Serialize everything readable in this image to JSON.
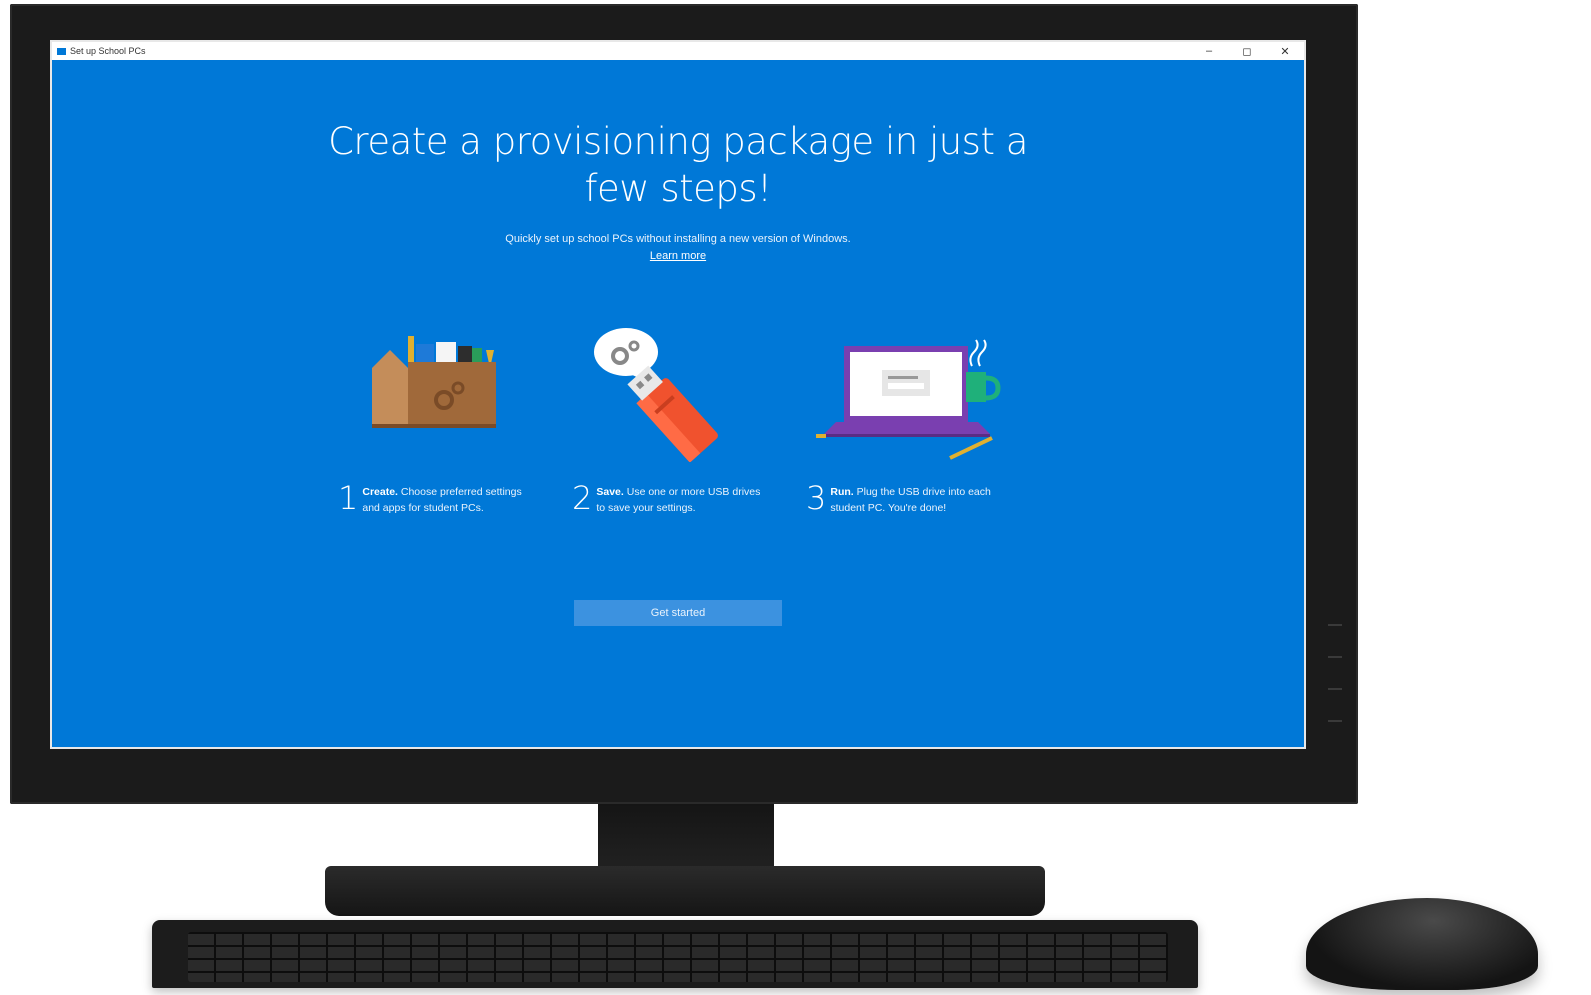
{
  "window": {
    "title": "Set up School PCs",
    "minimize": "–",
    "maximize": "◻",
    "close": "✕"
  },
  "main": {
    "headline_line1": "Create a provisioning package in just a",
    "headline_line2": "few steps!",
    "subtitle": "Quickly set up school PCs without installing a new version of Windows.",
    "learn_more": "Learn more",
    "steps": [
      {
        "number": "1",
        "bold": "Create.",
        "text_line1": " Choose preferred settings",
        "text_line2": "and apps for student PCs."
      },
      {
        "number": "2",
        "bold": "Save.",
        "text_line1": " Use one or more USB drives",
        "text_line2": "to save your settings."
      },
      {
        "number": "3",
        "bold": "Run.",
        "text_line1": " Plug the USB drive into each",
        "text_line2": "student PC. You're done!"
      }
    ],
    "get_started": "Get started"
  },
  "colors": {
    "screen_blue": "#0078d7",
    "button_blue": "#3c92e0",
    "toolbox_brown": "#a0693a",
    "usb_red": "#f0522e",
    "laptop_purple": "#7a3fb0",
    "mug_green": "#1fb07a"
  },
  "icons": [
    "toolbox-illustration",
    "usb-drive-illustration",
    "laptop-illustration"
  ]
}
